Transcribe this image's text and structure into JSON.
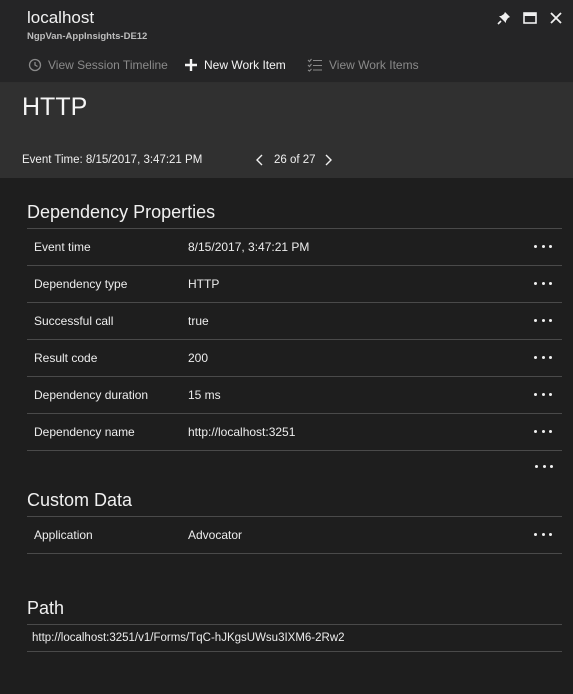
{
  "window": {
    "title": "localhost",
    "subtitle": "NgpVan-AppInsights-DE12",
    "pin_icon": "pin-icon",
    "maximize_icon": "maximize-icon",
    "close_icon": "close-icon"
  },
  "toolbar": {
    "view_session_timeline": "View Session Timeline",
    "new_work_item": "New Work Item",
    "view_work_items": "View Work Items"
  },
  "header": {
    "title": "HTTP",
    "event_time": "Event Time: 8/15/2017, 3:47:21 PM",
    "pager": "26 of 27"
  },
  "dependency_properties": {
    "title": "Dependency Properties",
    "rows": [
      {
        "key": "Event time",
        "value": "8/15/2017, 3:47:21 PM"
      },
      {
        "key": "Dependency type",
        "value": "HTTP"
      },
      {
        "key": "Successful call",
        "value": "true"
      },
      {
        "key": "Result code",
        "value": "200"
      },
      {
        "key": "Dependency duration",
        "value": "15 ms"
      },
      {
        "key": "Dependency name",
        "value": "http://localhost:3251"
      }
    ]
  },
  "custom_data": {
    "title": "Custom Data",
    "rows": [
      {
        "key": "Application",
        "value": "Advocator"
      }
    ]
  },
  "path": {
    "title": "Path",
    "value": "http://localhost:3251/v1/Forms/TqC-hJKgsUWsu3IXM6-2Rw2"
  },
  "colors": {
    "background": "#1e1e1e",
    "header": "#303030",
    "divider": "#4a4a4a"
  }
}
